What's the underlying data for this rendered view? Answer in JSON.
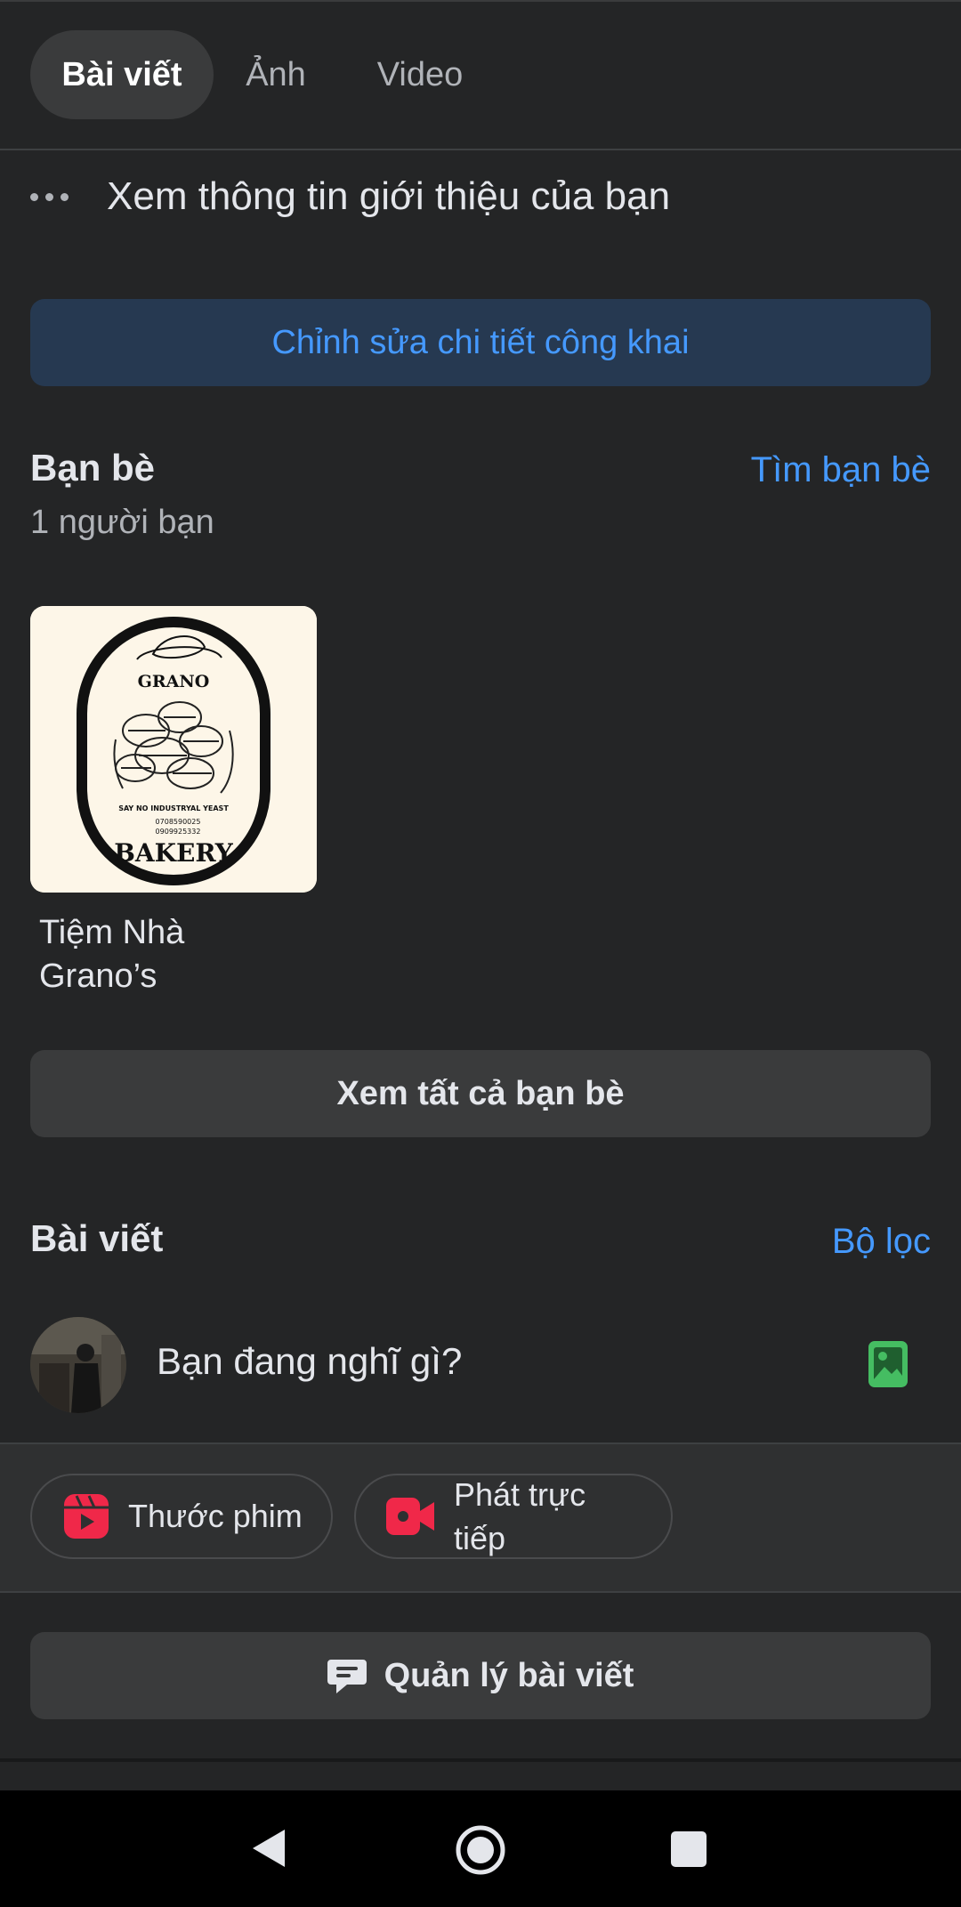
{
  "tabs": [
    {
      "label": "Bài viết",
      "active": true
    },
    {
      "label": "Ảnh",
      "active": false
    },
    {
      "label": "Video",
      "active": false
    }
  ],
  "intro": {
    "text": "Xem thông tin giới thiệu của bạn"
  },
  "edit_public_details": {
    "label": "Chỉnh sửa chi tiết công khai"
  },
  "friends": {
    "title": "Bạn bè",
    "find_link": "Tìm bạn bè",
    "count_text": "1 người bạn",
    "list": [
      {
        "name": "Tiệm Nhà Grano’s",
        "logo": {
          "top_text": "GRANO",
          "tagline": "SAY NO INDUSTRYAL YEAST",
          "phone1": "0708590025",
          "phone2": "0909925332",
          "bottom_text": "BAKERY"
        }
      }
    ],
    "see_all": "Xem tất cả bạn bè"
  },
  "posts": {
    "title": "Bài viết",
    "filter_link": "Bộ lọc",
    "composer_placeholder": "Bạn đang nghĩ gì?",
    "reels_label": "Thước phim",
    "live_label_line1": "Phát trực",
    "live_label_line2": "tiếp",
    "manage_label": "Quản lý bài viết"
  },
  "colors": {
    "background": "#242526",
    "accent_blue": "#4599ff",
    "reels_red": "#f02849",
    "photo_green": "#45bd62"
  },
  "icons": [
    "more-dots-icon",
    "photo-icon",
    "reels-icon",
    "live-video-icon",
    "manage-posts-icon",
    "back-icon",
    "home-icon",
    "recents-icon"
  ]
}
